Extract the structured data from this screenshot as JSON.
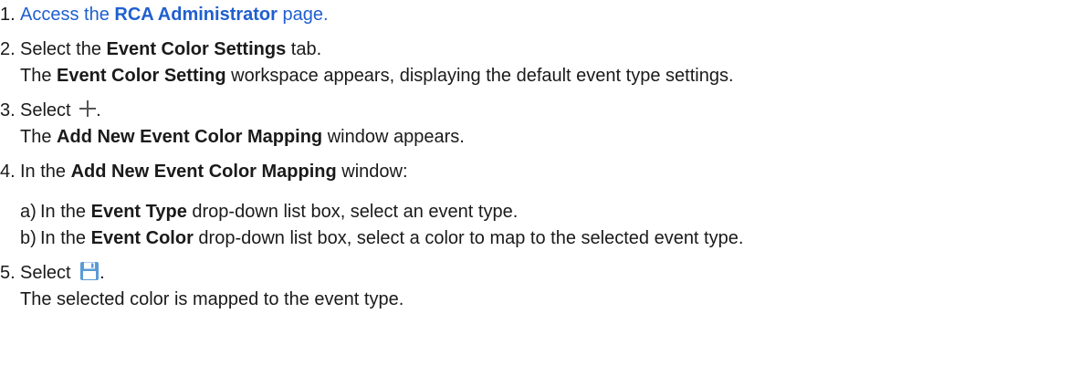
{
  "steps": [
    {
      "num": "1.",
      "pre": "Access the ",
      "bold": "RCA Administrator",
      "post": " page."
    },
    {
      "num": "2.",
      "pre": "Select the ",
      "bold": "Event Color Settings",
      "post": " tab.",
      "result_pre": "The ",
      "result_bold": "Event Color Setting",
      "result_post": " workspace appears, displaying the default event type settings."
    },
    {
      "num": "3.",
      "pre": "Select ",
      "icon": "plus-icon",
      "post": ".",
      "result_pre": "The ",
      "result_bold": "Add New Event Color Mapping",
      "result_post": " window appears."
    },
    {
      "num": "4.",
      "pre": "In the ",
      "bold": "Add New Event Color Mapping",
      "post": " window:",
      "substeps": [
        {
          "letter": "a)",
          "pre": "In the ",
          "bold": "Event Type",
          "post": " drop-down list box, select an event type."
        },
        {
          "letter": "b)",
          "pre": "In the ",
          "bold": "Event Color",
          "post": " drop-down list box, select a color to map to the selected event type."
        }
      ]
    },
    {
      "num": "5.",
      "pre": "Select ",
      "icon": "save-icon",
      "post": ".",
      "result": "The selected color is mapped to the event type."
    }
  ],
  "colors": {
    "link": "#1f5fcf",
    "text": "#1a1a1a",
    "save_icon": "#5b9bd5"
  }
}
